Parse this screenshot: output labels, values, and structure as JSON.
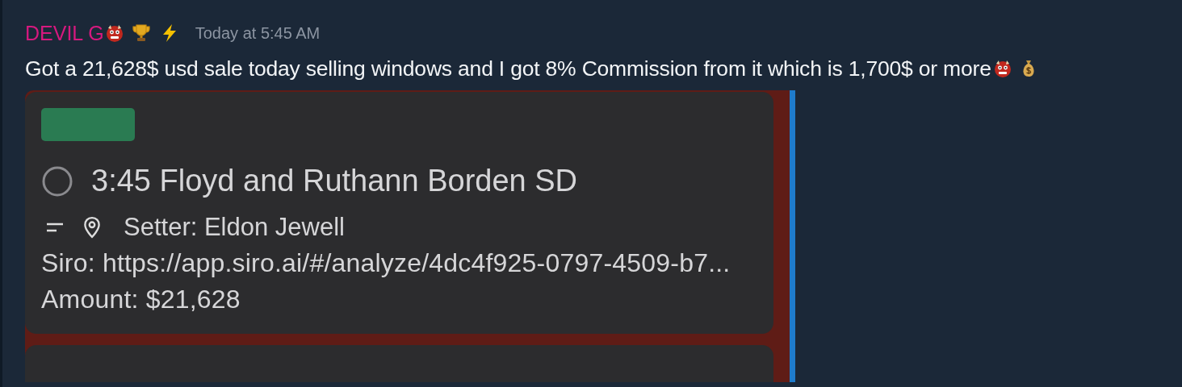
{
  "message": {
    "author": "DEVIL G",
    "timestamp": "Today at 5:45 AM",
    "text": "Got a 21,628$ usd sale today selling windows and I got 8% Commission from it which is 1,700$ or more"
  },
  "attachment": {
    "event": {
      "title": "3:45 Floyd and Ruthann Borden SD",
      "done": false,
      "setter": "Setter: Eldon Jewell",
      "siro": "Siro: https://app.siro.ai/#/analyze/4dc4f925-0797-4509-b7...",
      "amount": "Amount: $21,628"
    }
  }
}
